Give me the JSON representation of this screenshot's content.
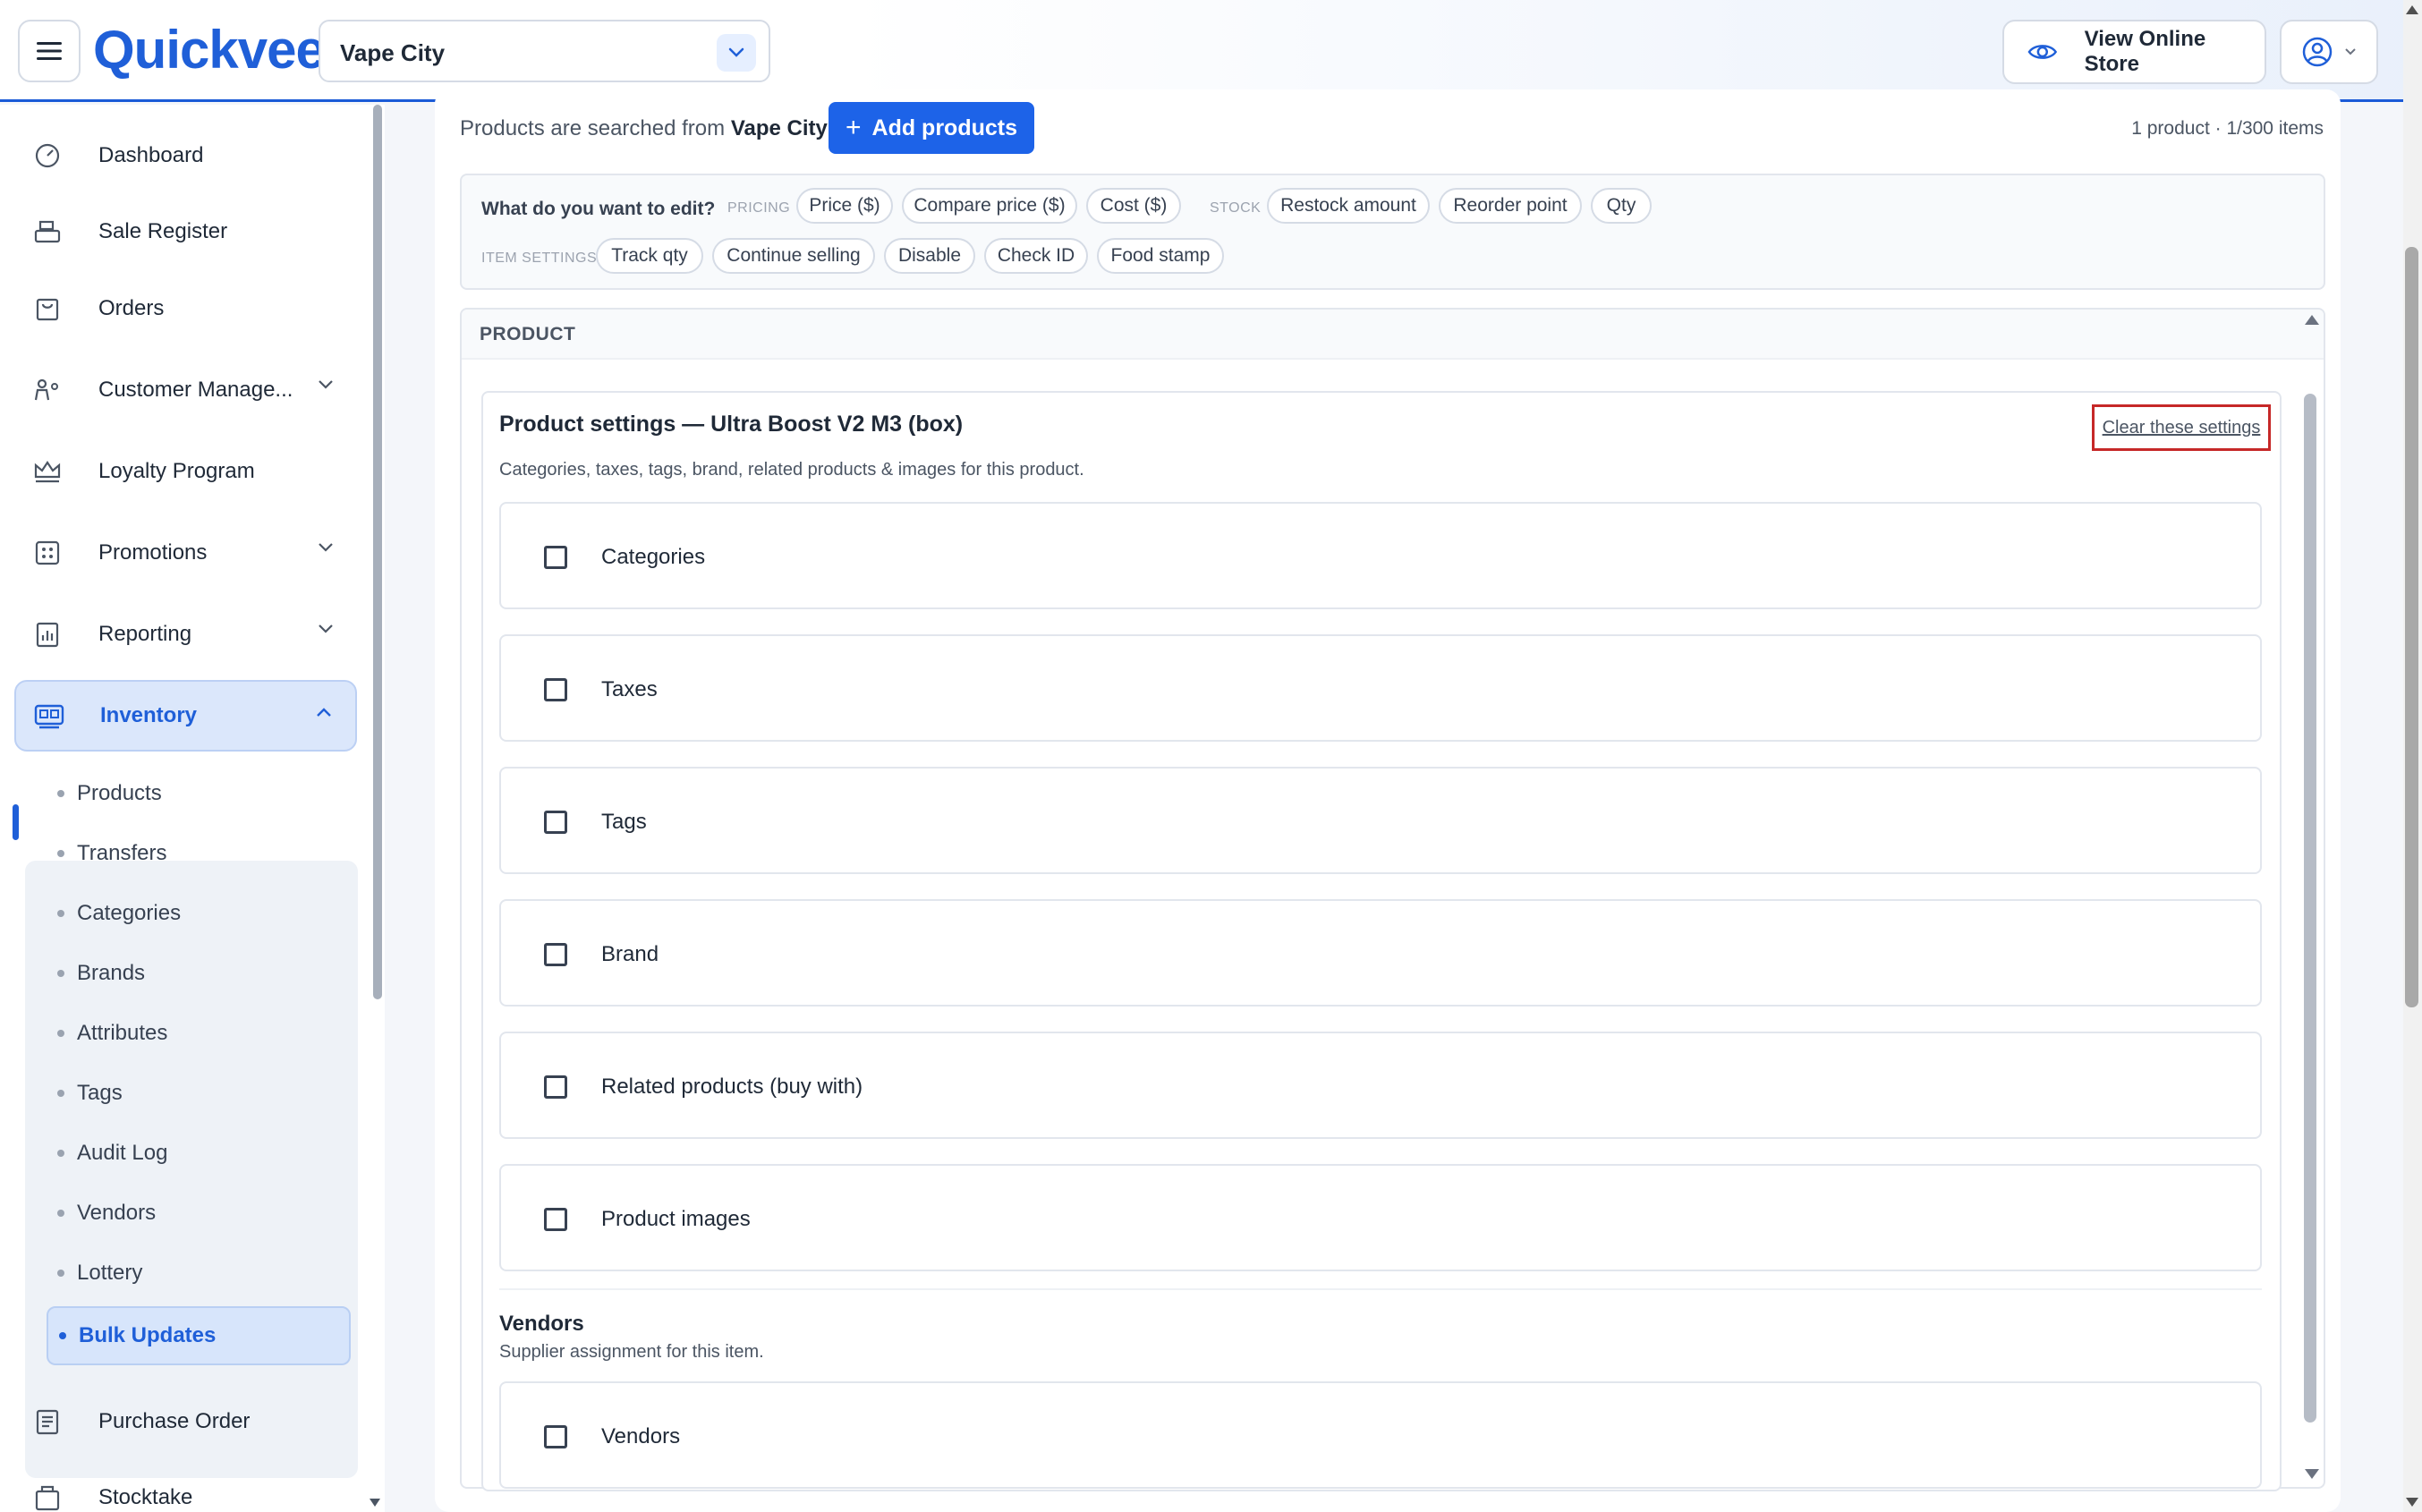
{
  "header": {
    "logo_text": "Quickvee",
    "store_name": "Vape City",
    "view_store_label": "View Online Store"
  },
  "sidebar": {
    "items": [
      {
        "label": "Dashboard",
        "icon": "dashboard-gauge-icon"
      },
      {
        "label": "Sale Register",
        "icon": "register-icon"
      },
      {
        "label": "Orders",
        "icon": "shopping-bag-icon"
      },
      {
        "label": "Customer Manage...",
        "icon": "customers-icon"
      },
      {
        "label": "Loyalty Program",
        "icon": "crown-icon"
      },
      {
        "label": "Promotions",
        "icon": "promotions-icon"
      },
      {
        "label": "Reporting",
        "icon": "report-icon"
      },
      {
        "label": "Inventory",
        "icon": "inventory-icon"
      },
      {
        "label": "Purchase Order",
        "icon": "purchase-order-icon"
      },
      {
        "label": "Stocktake",
        "icon": "stocktake-icon"
      }
    ],
    "inventory_sub": [
      {
        "label": "Products"
      },
      {
        "label": "Transfers"
      },
      {
        "label": "Categories"
      },
      {
        "label": "Brands"
      },
      {
        "label": "Attributes"
      },
      {
        "label": "Tags"
      },
      {
        "label": "Audit Log"
      },
      {
        "label": "Vendors"
      },
      {
        "label": "Lottery"
      },
      {
        "label": "Bulk Updates"
      }
    ]
  },
  "main": {
    "search_prefix": "Products are searched from",
    "search_store": "Vape City",
    "add_products_label": "Add products",
    "count_text": "1 product · 1/300 items",
    "edit_question": "What do you want to edit?",
    "pricing_label": "PRICING",
    "stock_label": "STOCK",
    "item_settings_label": "ITEM SETTINGS",
    "chips": {
      "price": "Price ($)",
      "compare_price": "Compare price ($)",
      "cost": "Cost ($)",
      "restock": "Restock amount",
      "reorder": "Reorder point",
      "qty": "Qty",
      "track_qty": "Track qty",
      "continue_selling": "Continue selling",
      "disable": "Disable",
      "check_id": "Check ID",
      "food_stamp": "Food stamp"
    },
    "product_header": "PRODUCT",
    "settings_title": "Product settings — Ultra Boost V2 M3 (box)",
    "settings_subtitle": "Categories, taxes, tags, brand, related products & images for this product.",
    "clear_label": "Clear these settings",
    "options": [
      {
        "label": "Categories"
      },
      {
        "label": "Taxes"
      },
      {
        "label": "Tags"
      },
      {
        "label": "Brand"
      },
      {
        "label": "Related products (buy with)"
      },
      {
        "label": "Product images"
      }
    ],
    "vendors_title": "Vendors",
    "vendors_subtitle": "Supplier assignment for this item.",
    "vendors_option": "Vendors"
  },
  "colors": {
    "accent": "#1f5fd8",
    "primary_button": "#1d63e8",
    "highlight_border": "#c62828"
  }
}
